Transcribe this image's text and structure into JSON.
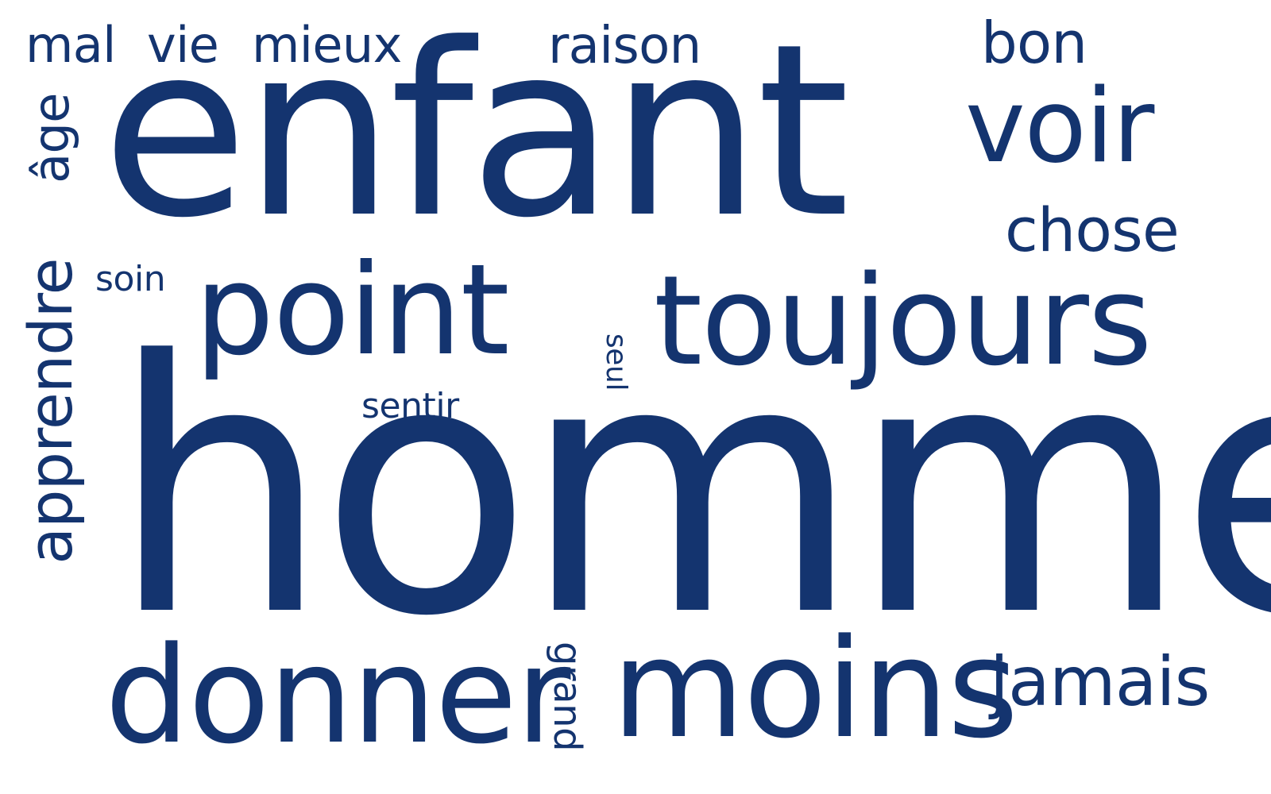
{
  "word_cloud": {
    "color": "#14346f",
    "words": [
      "mal",
      "vie",
      "mieux",
      "raison",
      "bon",
      "âge",
      "enfant",
      "voir",
      "chose",
      "apprendre",
      "soin",
      "point",
      "seul",
      "toujours",
      "sentir",
      "homme",
      "donner",
      "grand",
      "moins",
      "jamais"
    ]
  }
}
